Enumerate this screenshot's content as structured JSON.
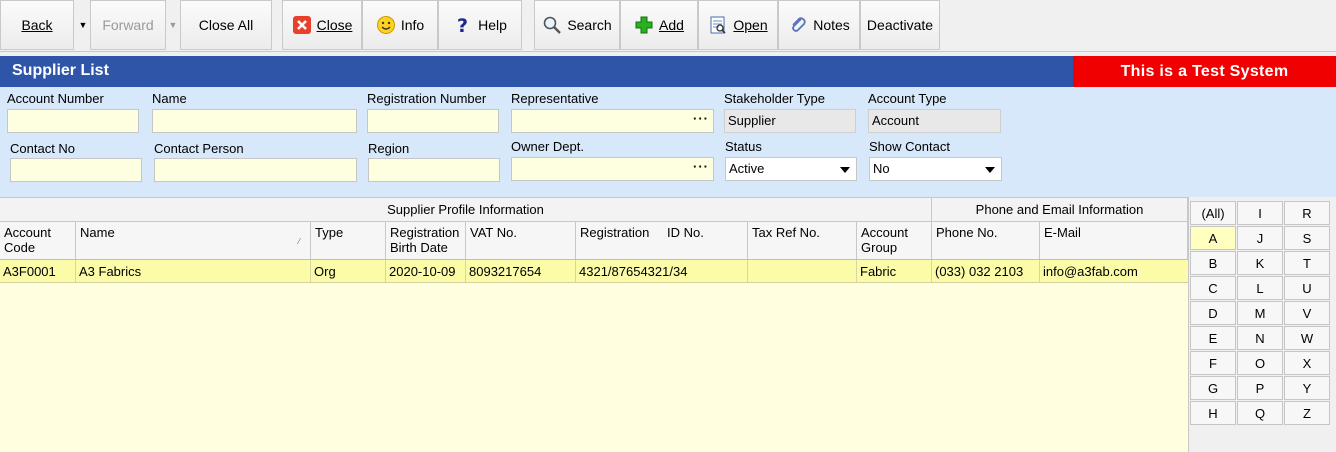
{
  "toolbar": {
    "back": "Back",
    "forward": "Forward",
    "close_all": "Close All",
    "close": "Close",
    "info": "Info",
    "help": "Help",
    "search": "Search",
    "add": "Add",
    "open": "Open",
    "notes": "Notes",
    "deactivate": "Deactivate"
  },
  "title": "Supplier List",
  "test_banner": "This is a Test System",
  "filters": {
    "account_number": {
      "label": "Account Number",
      "value": ""
    },
    "name": {
      "label": "Name",
      "value": ""
    },
    "registration_number": {
      "label": "Registration Number",
      "value": ""
    },
    "representative": {
      "label": "Representative",
      "value": ""
    },
    "stakeholder_type": {
      "label": "Stakeholder Type",
      "value": "Supplier"
    },
    "account_type": {
      "label": "Account Type",
      "value": "Account"
    },
    "contact_no": {
      "label": "Contact No",
      "value": ""
    },
    "contact_person": {
      "label": "Contact Person",
      "value": ""
    },
    "region": {
      "label": "Region",
      "value": ""
    },
    "owner_dept": {
      "label": "Owner Dept.",
      "value": ""
    },
    "status": {
      "label": "Status",
      "value": "Active"
    },
    "show_contact": {
      "label": "Show Contact",
      "value": "No"
    }
  },
  "grid": {
    "groups": {
      "profile": "Supplier Profile Information",
      "contact": "Phone and Email Information"
    },
    "columns": {
      "account_code": [
        "Account",
        "Code"
      ],
      "name": "Name",
      "type": "Type",
      "reg_birth_date": [
        "Registration",
        "Birth Date"
      ],
      "vat_no": "VAT No.",
      "registration": "Registration",
      "id_no": "ID No.",
      "tax_ref_no": "Tax Ref No.",
      "account_group": [
        "Account",
        "Group"
      ],
      "phone_no": "Phone No.",
      "email": "E-Mail"
    },
    "rows": [
      {
        "account_code": "A3F0001",
        "name": "A3 Fabrics",
        "type": "Org",
        "reg_birth_date": "2020-10-09",
        "vat_no": "8093217654",
        "registration_id": "4321/87654321/34",
        "tax_ref_no": "",
        "account_group": "Fabric",
        "phone_no": "(033) 032 2103",
        "email": "info@a3fab.com"
      }
    ]
  },
  "alphabet": {
    "col1": [
      "(All)",
      "A",
      "B",
      "C",
      "D",
      "E",
      "F",
      "G",
      "H"
    ],
    "col2": [
      "I",
      "J",
      "K",
      "L",
      "M",
      "N",
      "O",
      "P",
      "Q"
    ],
    "col3": [
      "R",
      "S",
      "T",
      "U",
      "V",
      "W",
      "X",
      "Y",
      "Z"
    ],
    "selected": "A"
  },
  "colors": {
    "titlebar": "#2e55a8",
    "test_banner": "#f00000",
    "filter_bg": "#d6e8fa",
    "row_highlight": "#fbfba8"
  }
}
